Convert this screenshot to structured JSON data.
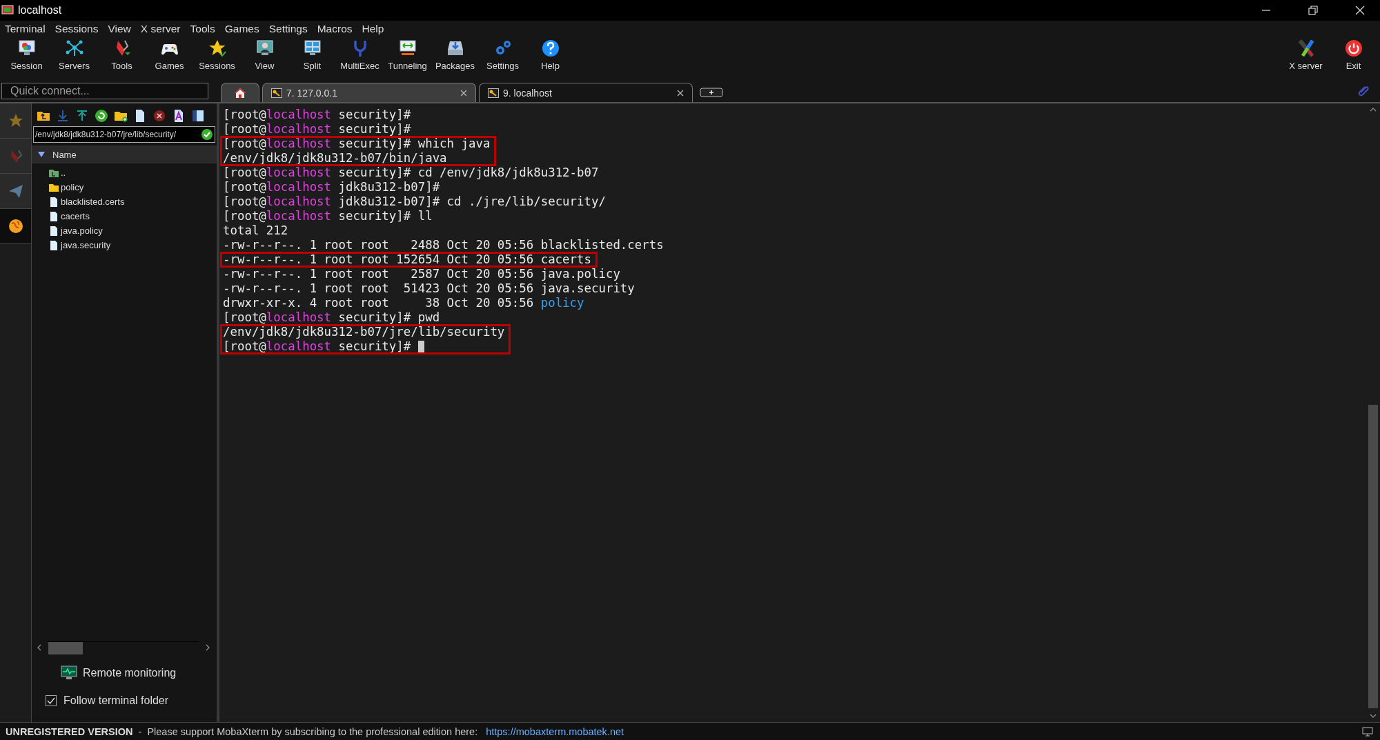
{
  "window": {
    "title": "localhost"
  },
  "menu": [
    "Terminal",
    "Sessions",
    "View",
    "X server",
    "Tools",
    "Games",
    "Settings",
    "Macros",
    "Help"
  ],
  "toolbar": [
    {
      "label": "Session"
    },
    {
      "label": "Servers"
    },
    {
      "label": "Tools"
    },
    {
      "label": "Games"
    },
    {
      "label": "Sessions"
    },
    {
      "label": "View"
    },
    {
      "label": "Split"
    },
    {
      "label": "MultiExec"
    },
    {
      "label": "Tunneling"
    },
    {
      "label": "Packages"
    },
    {
      "label": "Settings"
    },
    {
      "label": "Help"
    }
  ],
  "toolbar_right": [
    {
      "label": "X server"
    },
    {
      "label": "Exit"
    }
  ],
  "quick_connect": {
    "placeholder": "Quick connect..."
  },
  "tabs": [
    {
      "kind": "home",
      "selected": false
    },
    {
      "kind": "session",
      "label": "7. 127.0.0.1",
      "selected": false
    },
    {
      "kind": "session",
      "label": "9. localhost",
      "selected": true
    }
  ],
  "side_tabs": [
    {
      "selected": false
    },
    {
      "selected": false
    },
    {
      "selected": false
    },
    {
      "selected": true
    }
  ],
  "file_browser": {
    "path": "/env/jdk8/jdk8u312-b07/jre/lib/security/",
    "column": "Name",
    "files": [
      {
        "kind": "parent",
        "name": ".."
      },
      {
        "kind": "folder",
        "name": "policy"
      },
      {
        "kind": "file",
        "name": "blacklisted.certs"
      },
      {
        "kind": "file",
        "name": "cacerts"
      },
      {
        "kind": "file",
        "name": "java.policy"
      },
      {
        "kind": "file",
        "name": "java.security"
      }
    ],
    "remote_monitoring": "Remote monitoring",
    "follow_folder": {
      "label": "Follow terminal folder",
      "checked": true
    }
  },
  "terminal": {
    "cursor_visible": true,
    "blocks": [
      {
        "highlighted": false,
        "lines": [
          [
            {
              "kind": "text",
              "text": "[root@"
            },
            {
              "kind": "host",
              "text": "localhost"
            },
            {
              "kind": "text",
              "text": " security]#"
            }
          ],
          [
            {
              "kind": "text",
              "text": "[root@"
            },
            {
              "kind": "host",
              "text": "localhost"
            },
            {
              "kind": "text",
              "text": " security]#"
            }
          ]
        ]
      },
      {
        "highlighted": true,
        "lines": [
          [
            {
              "kind": "text",
              "text": "[root@"
            },
            {
              "kind": "host",
              "text": "localhost"
            },
            {
              "kind": "text",
              "text": " security]# which java"
            }
          ],
          [
            {
              "kind": "text",
              "text": "/env/jdk8/jdk8u312-b07/bin/java"
            }
          ]
        ]
      },
      {
        "highlighted": false,
        "lines": [
          [
            {
              "kind": "text",
              "text": "[root@"
            },
            {
              "kind": "host",
              "text": "localhost"
            },
            {
              "kind": "text",
              "text": " security]# cd /env/jdk8/jdk8u312-b07"
            }
          ],
          [
            {
              "kind": "text",
              "text": "[root@"
            },
            {
              "kind": "host",
              "text": "localhost"
            },
            {
              "kind": "text",
              "text": " jdk8u312-b07]#"
            }
          ],
          [
            {
              "kind": "text",
              "text": "[root@"
            },
            {
              "kind": "host",
              "text": "localhost"
            },
            {
              "kind": "text",
              "text": " jdk8u312-b07]# cd ./jre/lib/security/"
            }
          ],
          [
            {
              "kind": "text",
              "text": "[root@"
            },
            {
              "kind": "host",
              "text": "localhost"
            },
            {
              "kind": "text",
              "text": " security]# ll"
            }
          ],
          [
            {
              "kind": "text",
              "text": "total 212"
            }
          ],
          [
            {
              "kind": "text",
              "text": "-rw-r--r--. 1 root root   2488 Oct 20 05:56 blacklisted.certs"
            }
          ]
        ]
      },
      {
        "highlighted": true,
        "lines": [
          [
            {
              "kind": "text",
              "text": "-rw-r--r--. 1 root root 152654 Oct 20 05:56 cacerts"
            }
          ]
        ]
      },
      {
        "highlighted": false,
        "lines": [
          [
            {
              "kind": "text",
              "text": "-rw-r--r--. 1 root root   2587 Oct 20 05:56 java.policy"
            }
          ],
          [
            {
              "kind": "text",
              "text": "-rw-r--r--. 1 root root  51423 Oct 20 05:56 java.security"
            }
          ],
          [
            {
              "kind": "text",
              "text": "drwxr-xr-x. 4 root root     38 Oct 20 05:56 "
            },
            {
              "kind": "dir",
              "text": "policy"
            }
          ],
          [
            {
              "kind": "text",
              "text": "[root@"
            },
            {
              "kind": "host",
              "text": "localhost"
            },
            {
              "kind": "text",
              "text": " security]# pwd"
            }
          ]
        ]
      },
      {
        "highlighted": true,
        "lines": [
          [
            {
              "kind": "text",
              "text": "/env/jdk8/jdk8u312-b07/jre/lib/security"
            }
          ],
          [
            {
              "kind": "text",
              "text": "[root@"
            },
            {
              "kind": "host",
              "text": "localhost"
            },
            {
              "kind": "text",
              "text": " security]# "
            }
          ]
        ]
      }
    ]
  },
  "status_bar": {
    "edition": "UNREGISTERED VERSION",
    "message": " -  Please support MobaXterm by subscribing to the professional edition here:",
    "link": "https://mobaxterm.mobatek.net"
  }
}
